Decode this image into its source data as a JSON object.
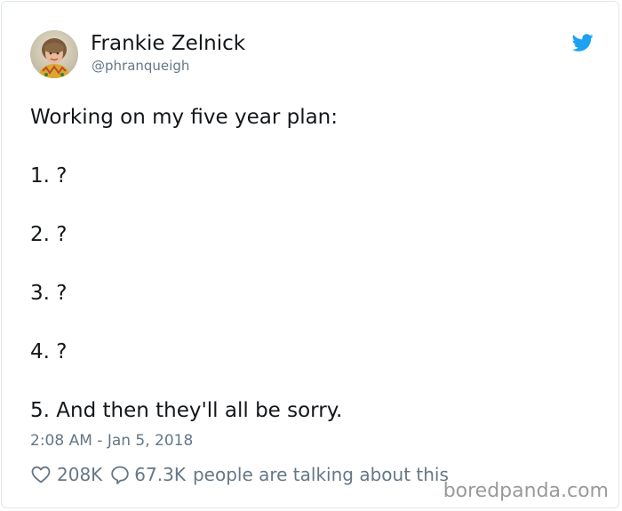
{
  "user": {
    "display_name": "Frankie Zelnick",
    "handle": "@phranqueigh"
  },
  "tweet": {
    "lines": [
      "Working on my five year plan:",
      "1. ?",
      "2. ?",
      "3. ?",
      "4. ?",
      "5. And then they'll all be sorry."
    ],
    "timestamp": "2:08 AM - Jan 5, 2018"
  },
  "stats": {
    "likes": "208K",
    "replies": "67.3K",
    "talking_label": "people are talking about this"
  },
  "watermark": "boredpanda.com",
  "icons": {
    "brand": "twitter-bird-icon",
    "like": "heart-icon",
    "reply": "speech-bubble-icon"
  },
  "colors": {
    "twitter_blue": "#1da1f2",
    "text_primary": "#14171a",
    "text_secondary": "#657786"
  }
}
